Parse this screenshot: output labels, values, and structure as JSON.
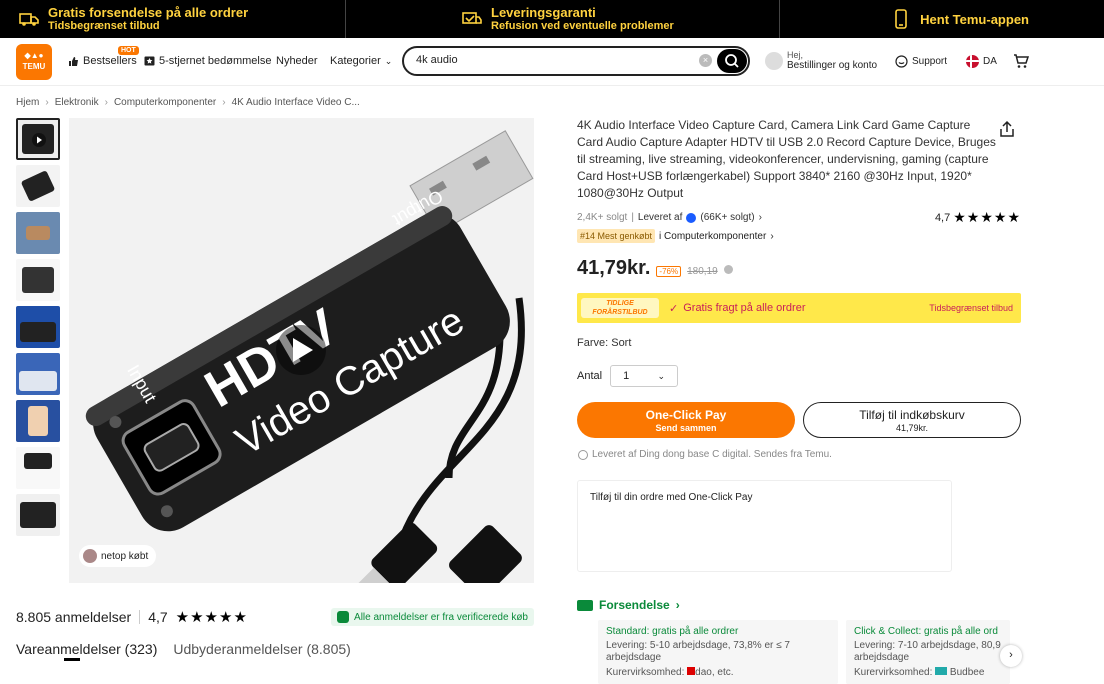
{
  "promo": {
    "free_shipping_title": "Gratis forsendelse på alle ordrer",
    "free_shipping_sub": "Tidsbegrænset tilbud",
    "guarantee_title": "Leveringsgaranti",
    "guarantee_sub": "Refusion ved eventuelle problemer",
    "app_label": "Hent Temu-appen"
  },
  "header": {
    "logo_text": "TEMU",
    "nav": {
      "bestsellers": "Bestsellers",
      "hot_badge": "HOT",
      "five_star": "5-stjernet bedømmelse",
      "news": "Nyheder",
      "categories": "Kategorier"
    },
    "search": {
      "value": "4k audio"
    },
    "account": {
      "greeting": "Hej,",
      "label": "Bestillinger og konto"
    },
    "support": "Support",
    "language": "DA"
  },
  "breadcrumb": [
    "Hjem",
    "Elektronik",
    "Computerkomponenter",
    "4K Audio Interface Video C..."
  ],
  "gallery": {
    "image_text_1": "HDTV",
    "image_text_2": "Video Capture",
    "image_text_output": "Output",
    "image_text_input": "Input",
    "just_bought": "netop købt"
  },
  "reviews": {
    "count": "8.805 anmeldelser",
    "rating": "4,7",
    "verified": "Alle anmeldelser er fra verificerede køb",
    "tab_product": "Vareanmeldelser (323)",
    "tab_seller": "Udbyderanmeldelser (8.805)"
  },
  "product": {
    "title": "4K Audio Interface Video Capture Card, Camera Link Card Game Capture Card Audio Capture Adapter HDTV til USB 2.0 Record Capture Device, Bruges til streaming, live streaming, videokonferencer, undervisning, gaming (capture Card Host+USB forlængerkabel) Support 3840* 2160 @30Hz Input, 1920* 1080@30Hz Output",
    "sold": "2,4K+ solgt",
    "delivered_by": "Leveret af",
    "seller_sold": "(66K+ solgt)",
    "rating": "4,7",
    "rank_badge": "#14 Mest genkøbt",
    "rank_category": "i Computerkomponenter",
    "price": "41,79kr.",
    "discount": "-76%",
    "old_price": "180,19",
    "banner_logo": "TIDLIGE FORÅRSTILBUD",
    "banner_text": "Gratis fragt på alle ordrer",
    "banner_right": "Tidsbegrænset tilbud",
    "color_label": "Farve: Sort",
    "qty_label": "Antal",
    "qty_value": "1",
    "oneclick_label": "One-Click Pay",
    "oneclick_sub": "Send sammen",
    "cart_label": "Tilføj til indkøbskurv",
    "cart_price": "41,79kr.",
    "delivered_note": "Leveret af Ding dong base C digital. Sendes fra Temu.",
    "oneclick_box": "Tilføj til din ordre med One-Click Pay"
  },
  "shipping": {
    "title": "Forsendelse",
    "standard_head": "Standard: gratis på alle ordrer",
    "standard_delivery": "Levering: 5-10 arbejdsdage, 73,8% er ≤ 7 arbejdsdage",
    "standard_courier": "Kurervirksomhed:",
    "standard_courier_value": "dao, etc.",
    "click_head": "Click & Collect: gratis på alle ord",
    "click_delivery": "Levering: 7-10 arbejdsdage, 80,9 arbejdsdage",
    "click_courier": "Kurervirksomhed:",
    "click_courier_value": "Budbee"
  },
  "colors": {
    "accent": "#fb7701",
    "promo": "#ffd23f",
    "green": "#0a8a3a",
    "banner": "#ffe84a"
  }
}
